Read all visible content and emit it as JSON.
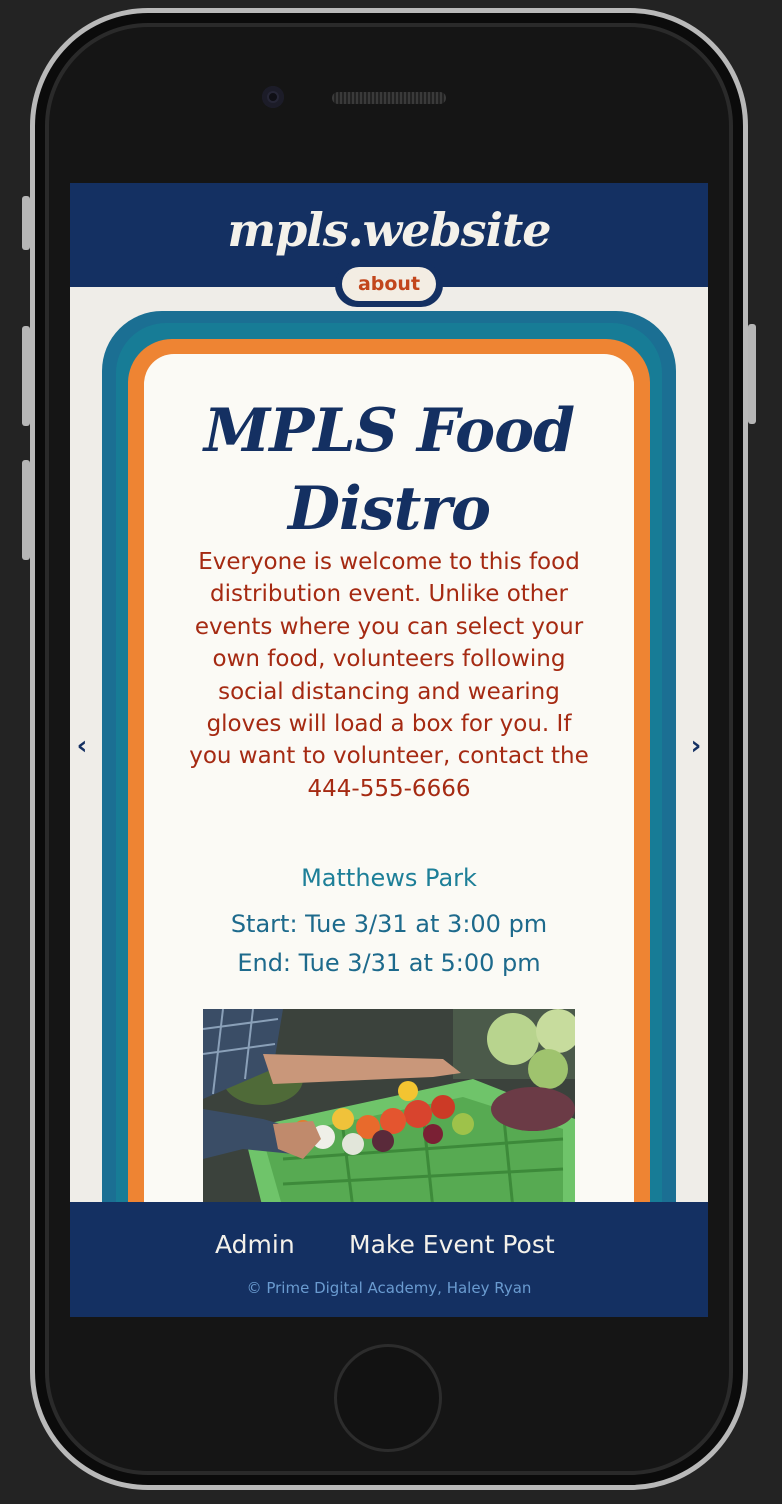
{
  "header": {
    "brand": "mpls.website",
    "about_label": "about"
  },
  "event": {
    "title": "MPLS Food Distro",
    "description": "Everyone is welcome to this food distribution event. Unlike other events where you can select your own food, volunteers following social distancing and wearing gloves will load a box for you. If you want to volunteer, contact the 444-555-6666",
    "location": "Matthews Park",
    "start": "Start: Tue 3/31 at 3:00 pm",
    "end": "End: Tue 3/31 at 5:00 pm"
  },
  "carousel": {
    "prev_icon": "‹",
    "next_icon": "›"
  },
  "footer": {
    "links": [
      "Admin",
      "Make Event Post"
    ],
    "copyright": "© Prime Digital Academy, Haley Ryan"
  },
  "colors": {
    "navy": "#143062",
    "teal": "#1b6f93",
    "orange": "#ee8433",
    "rust": "#a52a12",
    "cream": "#fbfaf5"
  }
}
